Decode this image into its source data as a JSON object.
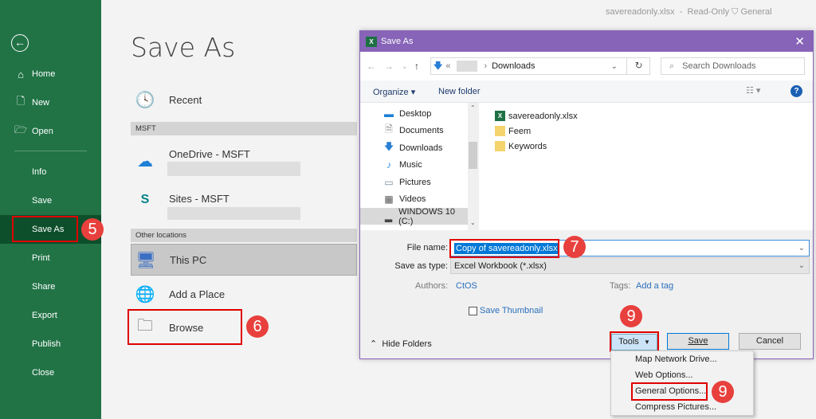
{
  "window": {
    "file_title": "savereadonly.xlsx",
    "mode": "Read-Only",
    "sensitivity": "General"
  },
  "sidebar": {
    "back_icon": "back-arrow-circle-icon",
    "items": [
      {
        "label": "Home",
        "icon": "home-icon"
      },
      {
        "label": "New",
        "icon": "new-document-icon"
      },
      {
        "label": "Open",
        "icon": "open-folder-icon"
      },
      {
        "label": "Info"
      },
      {
        "label": "Save"
      },
      {
        "label": "Save As",
        "selected": true
      },
      {
        "label": "Print"
      },
      {
        "label": "Share"
      },
      {
        "label": "Export"
      },
      {
        "label": "Publish"
      },
      {
        "label": "Close"
      }
    ]
  },
  "main": {
    "title": "Save As",
    "recent_label": "Recent",
    "sections": {
      "msft": "MSFT",
      "other": "Other locations"
    },
    "locations": [
      {
        "label": "OneDrive - MSFT",
        "icon": "onedrive-cloud-icon"
      },
      {
        "label": "Sites - MSFT",
        "icon": "sharepoint-icon"
      },
      {
        "label": "This PC",
        "icon": "this-pc-icon",
        "selected": true
      },
      {
        "label": "Add a Place",
        "icon": "globe-add-icon"
      },
      {
        "label": "Browse",
        "icon": "folder-icon"
      }
    ]
  },
  "dialog": {
    "title": "Save As",
    "breadcrumb": {
      "prefix": "«",
      "current": "Downloads"
    },
    "search_placeholder": "Search Downloads",
    "toolbar": {
      "organize": "Organize ▾",
      "new_folder": "New folder"
    },
    "tree": [
      {
        "label": "Desktop"
      },
      {
        "label": "Documents"
      },
      {
        "label": "Downloads"
      },
      {
        "label": "Music"
      },
      {
        "label": "Pictures"
      },
      {
        "label": "Videos"
      },
      {
        "label": "WINDOWS 10 (C:)",
        "selected": true
      }
    ],
    "files": [
      {
        "name": "savereadonly.xlsx",
        "type": "excel"
      },
      {
        "name": "Feem",
        "type": "folder"
      },
      {
        "name": "Keywords",
        "type": "folder"
      }
    ],
    "file_name_label": "File name:",
    "file_name_value": "Copy of savereadonly.xlsx",
    "save_type_label": "Save as type:",
    "save_type_value": "Excel Workbook (*.xlsx)",
    "authors_label": "Authors:",
    "authors_value": "CtOS",
    "tags_label": "Tags:",
    "tags_value": "Add a tag",
    "save_thumbnail_label": "Save Thumbnail",
    "save_thumbnail_checked": false,
    "hide_folders": "Hide Folders",
    "tools_label": "Tools",
    "save_label": "Save",
    "cancel_label": "Cancel"
  },
  "tools_menu": [
    "Map Network Drive...",
    "Web Options...",
    "General Options...",
    "Compress Pictures..."
  ],
  "annotations": {
    "step5": "5",
    "step6": "6",
    "step7": "7",
    "step9a": "9",
    "step9b": "9"
  },
  "colors": {
    "excel_green": "#217346",
    "dialog_purple": "#8764b8",
    "highlight_red": "#e00000",
    "badge_red": "#e8403d"
  }
}
